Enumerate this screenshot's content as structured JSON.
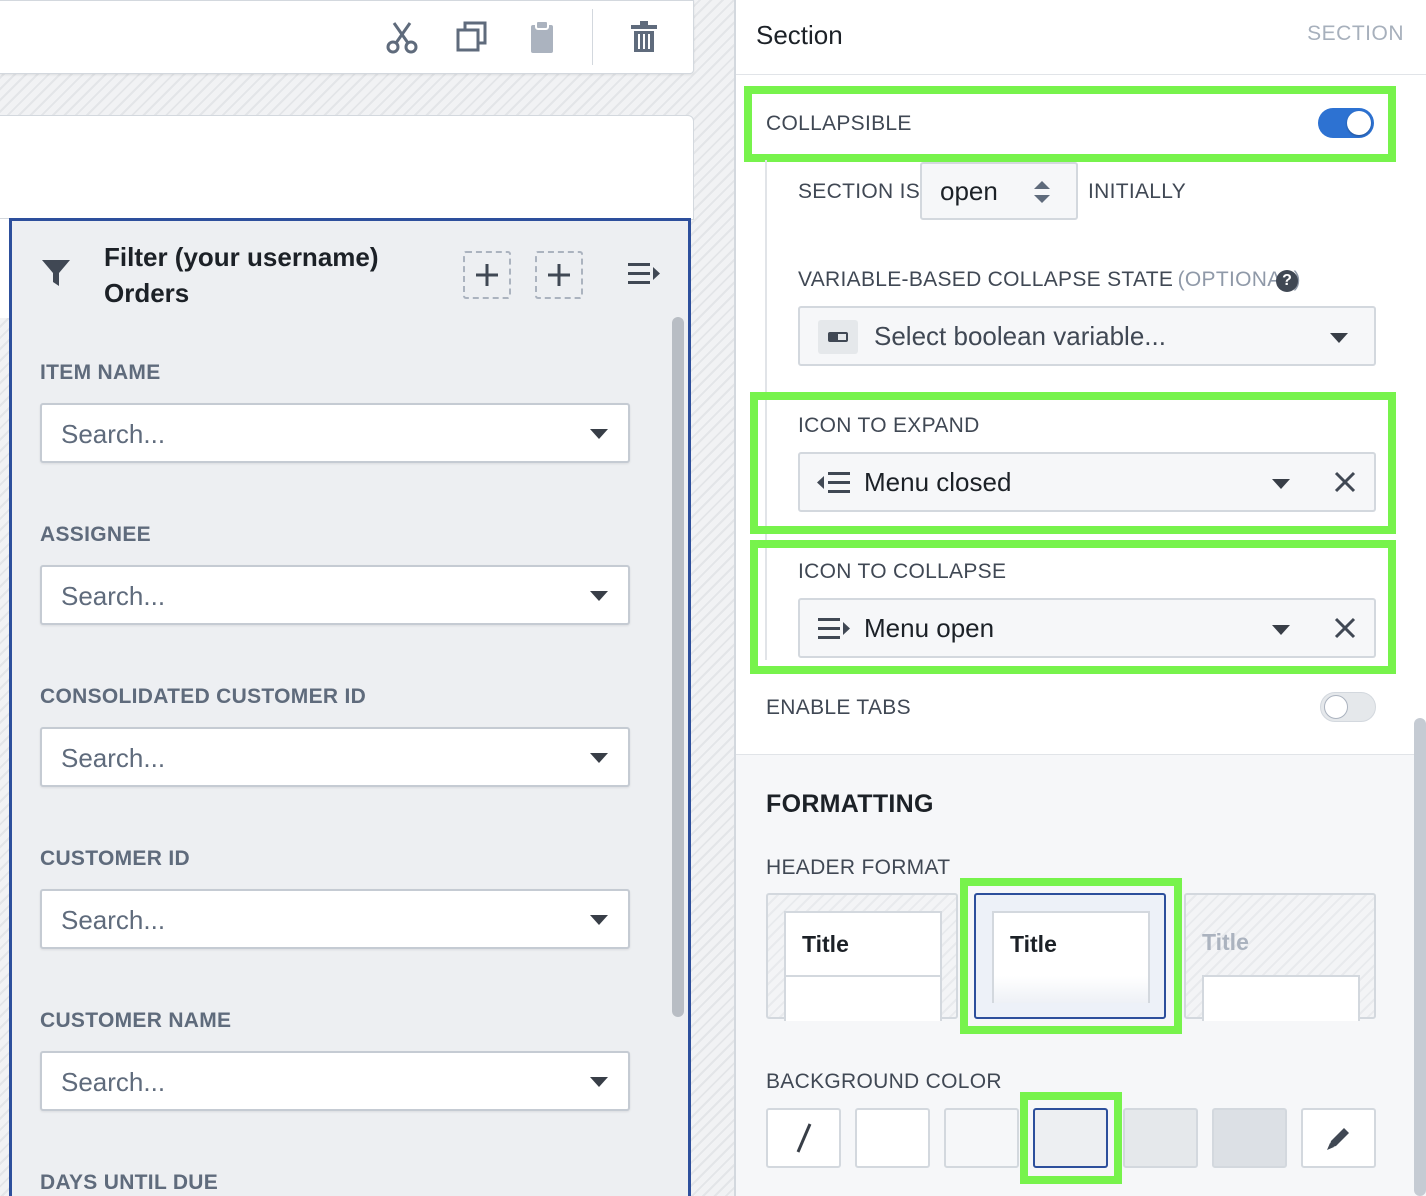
{
  "toolbar": {
    "icons": [
      "cut-icon",
      "duplicate-icon",
      "paste-icon",
      "trash-icon"
    ]
  },
  "filter_widget": {
    "title": "Filter (your username) Orders",
    "fields": [
      {
        "label": "ITEM NAME",
        "placeholder": "Search..."
      },
      {
        "label": "ASSIGNEE",
        "placeholder": "Search..."
      },
      {
        "label": "CONSOLIDATED CUSTOMER ID",
        "placeholder": "Search..."
      },
      {
        "label": "CUSTOMER ID",
        "placeholder": "Search..."
      },
      {
        "label": "CUSTOMER NAME",
        "placeholder": "Search..."
      },
      {
        "label": "DAYS UNTIL DUE",
        "placeholder": ""
      }
    ]
  },
  "panel": {
    "title": "Section",
    "type_label": "SECTION",
    "collapsible": {
      "label": "COLLAPSIBLE",
      "enabled": true
    },
    "initial_state": {
      "prefix": "SECTION IS",
      "value": "open",
      "suffix": "INITIALLY"
    },
    "variable_state": {
      "label": "VARIABLE-BASED COLLAPSE STATE",
      "optional": "(OPTIONAL)",
      "placeholder": "Select boolean variable..."
    },
    "icon_expand": {
      "label": "ICON TO EXPAND",
      "value": "Menu closed"
    },
    "icon_collapse": {
      "label": "ICON TO COLLAPSE",
      "value": "Menu open"
    },
    "enable_tabs": {
      "label": "ENABLE TABS",
      "enabled": false
    },
    "formatting": {
      "heading": "FORMATTING",
      "header_format_label": "HEADER FORMAT",
      "header_formats": [
        "Title",
        "Title",
        "Title"
      ],
      "selected_header_format": 1,
      "background_label": "BACKGROUND COLOR",
      "swatches": [
        "none",
        "#ffffff",
        "#f6f7f9",
        "#edeff2",
        "#e5e8eb",
        "#dce0e5",
        "custom"
      ],
      "selected_swatch": 3
    }
  },
  "colors": {
    "accent": "#2d72d2",
    "highlight": "#77f34c",
    "selected_border": "#2d4f9c"
  }
}
